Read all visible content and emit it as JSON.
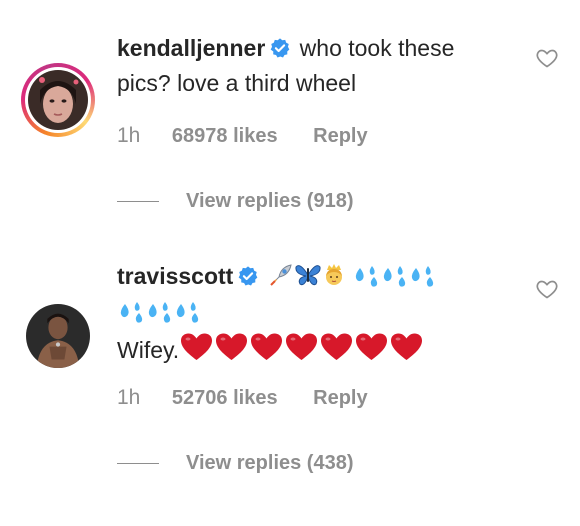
{
  "comments": [
    {
      "username": "kendalljenner",
      "verified": true,
      "text_line1": "who took these",
      "text_line2": "pics? love a third wheel",
      "time": "1h",
      "likes": "68978 likes",
      "reply_label": "Reply",
      "view_replies_label": "View replies (918)",
      "avatar_ring": true
    },
    {
      "username": "travisscott",
      "verified": true,
      "emojis_line1": [
        "rocket-emoji",
        "butterfly-emoji",
        "princess-emoji",
        "sweat-droplets-emoji",
        "sweat-droplets-emoji",
        "sweat-droplets-emoji"
      ],
      "emojis_line2": [
        "sweat-droplets-emoji",
        "sweat-droplets-emoji",
        "sweat-droplets-emoji"
      ],
      "text": "Wifey.",
      "hearts_count": 7,
      "time": "1h",
      "likes": "52706 likes",
      "reply_label": "Reply",
      "view_replies_label": "View replies (438)",
      "avatar_ring": false
    }
  ],
  "colors": {
    "text": "#262626",
    "meta": "#8e8e8e",
    "verified": "#3897f0",
    "heart_emoji": "#d7182a"
  }
}
